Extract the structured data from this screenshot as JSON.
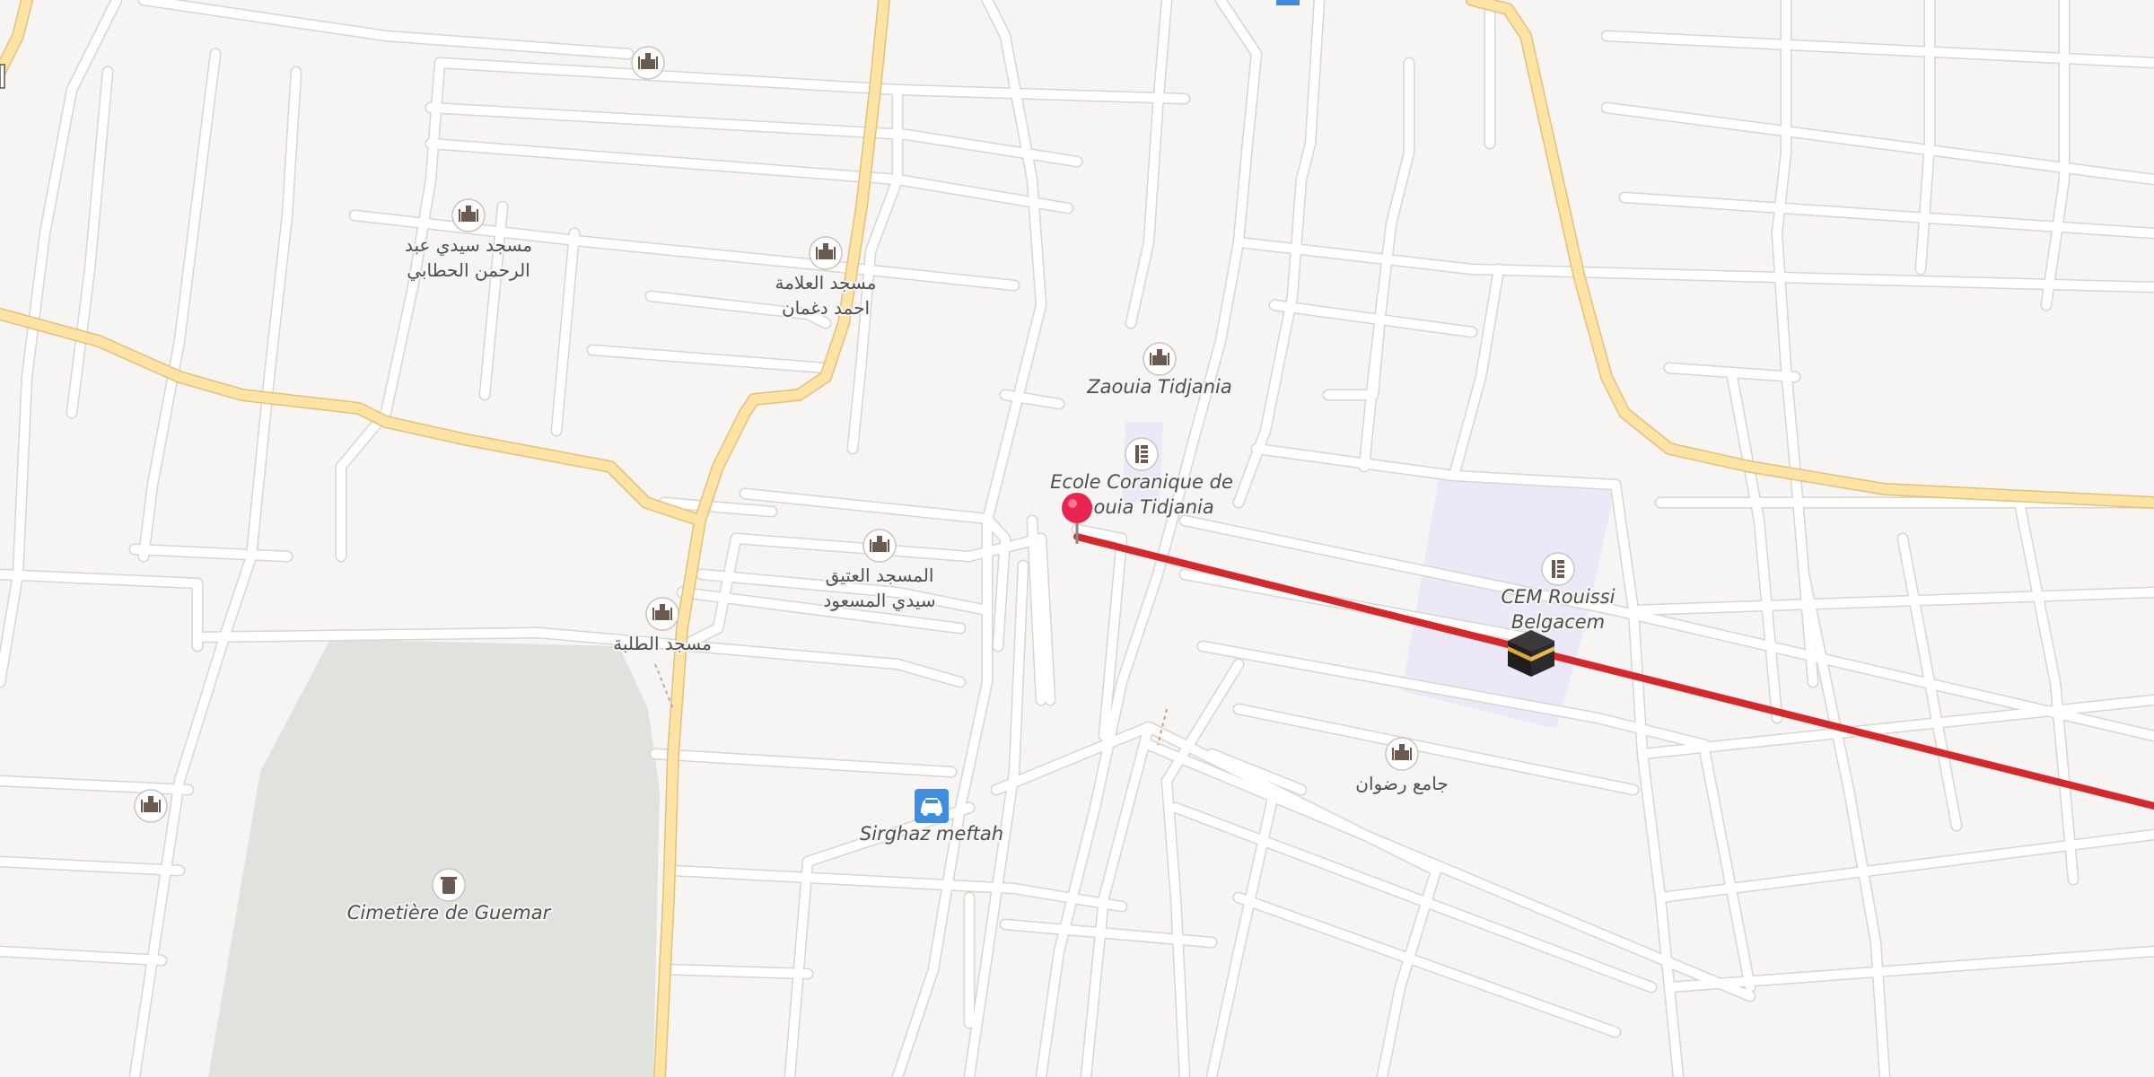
{
  "map": {
    "colors": {
      "background": "#f7f5f3",
      "street": "#ffffff",
      "main_road": "#fde4a4",
      "main_road_casing": "#e6bf7c",
      "cemetery": "#e0e3dd",
      "school_area": "#ede8f8",
      "route_line": "#d6282a",
      "pin": "#e8244f",
      "parking": "#3f8de0"
    },
    "labels": {
      "mosque_abderrahmane_l1": "مسجد سيدي عبد",
      "mosque_abderrahmane_l2": "الرحمن الحطابي",
      "mosque_allama_l1": "مسجد العلامة",
      "mosque_allama_l2": "احمد دغمان",
      "zaouia": "Zaouia Tidjania",
      "ecole_l1": "Ecole Coranique de",
      "ecole_l2": "Zaouia Tidjania",
      "mosque_atiq_l1": "المسجد العتيق",
      "mosque_atiq_l2": "سيدي المسعود",
      "mosque_talaba": "مسجد الطلبة",
      "cem_l1": "CEM Rouissi",
      "cem_l2": "Belgacem",
      "mosque_radwan": "جامع رضوان",
      "parking": "Sirghaz meftah",
      "cemetery": "Cimetière de Guemar"
    },
    "icons": {
      "mosque": "mosque-icon",
      "school": "school-icon",
      "cemetery": "cemetery-icon",
      "parking": "parking-car-icon",
      "kaaba": "kaaba-qibla-icon",
      "pin": "location-pin-icon"
    }
  }
}
